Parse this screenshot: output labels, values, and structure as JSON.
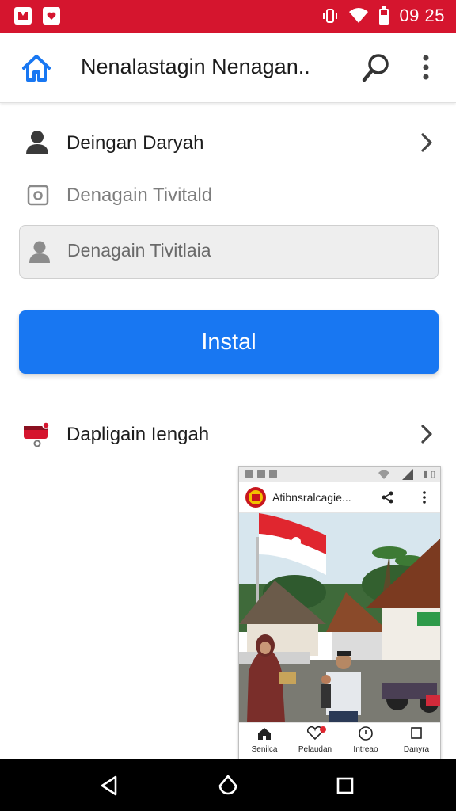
{
  "status_bar": {
    "time": "09 25",
    "background": "#d5152e",
    "left_icons": [
      "gallery-icon",
      "heart-app-icon"
    ],
    "right_icons": [
      "vibrate-icon",
      "wifi-icon",
      "battery-icon"
    ]
  },
  "app_bar": {
    "title": "Nenalastagin Nenagan..",
    "icons": [
      "home-icon",
      "search-icon",
      "more-vert-icon"
    ]
  },
  "content": {
    "profile_row": {
      "label": "Deingan Daryah",
      "icon": "person-icon"
    },
    "secondary_row": {
      "label": "Denagain Tivitald",
      "icon": "camera-icon"
    },
    "input": {
      "value": "Denagain Tivitlaia",
      "icon": "person-icon"
    },
    "install_button": {
      "label": "Instal",
      "color": "#1877f2"
    },
    "second_row": {
      "label": "Dapligain Iengah",
      "icon": "mailbox-icon"
    }
  },
  "preview": {
    "title": "Atibnsralcagie...",
    "tabs": [
      {
        "label": "Senilca",
        "icon": "home-icon"
      },
      {
        "label": "Pelaudan",
        "icon": "heart-icon"
      },
      {
        "label": "Intreao",
        "icon": "compass-icon"
      },
      {
        "label": "Danyra",
        "icon": "square-icon"
      }
    ]
  },
  "nav_bar": {
    "buttons": [
      "back-icon",
      "home-circle-icon",
      "recents-icon"
    ]
  }
}
